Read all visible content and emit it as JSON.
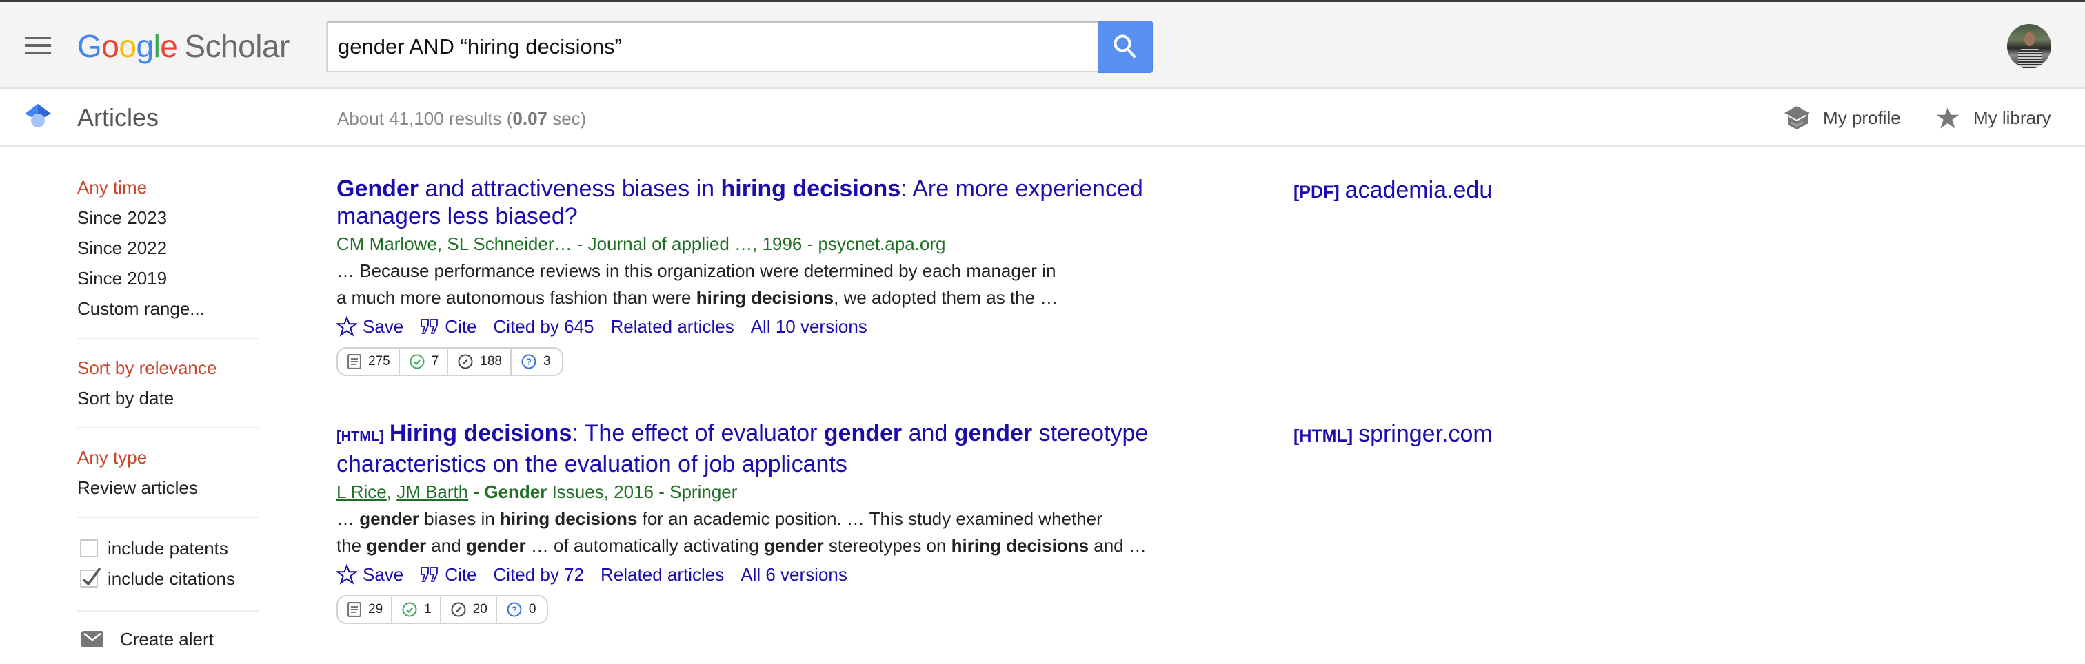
{
  "header": {
    "logo_google": [
      "G",
      "o",
      "o",
      "g",
      "l",
      "e"
    ],
    "logo_product": "Scholar",
    "search": {
      "value": "gender AND “hiring decisions”",
      "placeholder": ""
    },
    "icons": {
      "menu": "hamburger-menu-icon",
      "search": "magnifier-icon",
      "avatar": "user-avatar"
    }
  },
  "subheader": {
    "section_label": "Articles",
    "results_prefix": "About 41,100 results (",
    "results_time": "0.07",
    "results_suffix": " sec)",
    "my_profile": "My profile",
    "my_library": "My library"
  },
  "sidebar": {
    "time_filters": [
      {
        "label": "Any time",
        "active": true
      },
      {
        "label": "Since 2023",
        "active": false
      },
      {
        "label": "Since 2022",
        "active": false
      },
      {
        "label": "Since 2019",
        "active": false
      },
      {
        "label": "Custom range...",
        "active": false
      }
    ],
    "sort_options": [
      {
        "label": "Sort by relevance",
        "active": true
      },
      {
        "label": "Sort by date",
        "active": false
      }
    ],
    "type_filters": [
      {
        "label": "Any type",
        "active": true
      },
      {
        "label": "Review articles",
        "active": false
      }
    ],
    "checkboxes": [
      {
        "label": "include patents",
        "checked": false
      },
      {
        "label": "include citations",
        "checked": true
      }
    ],
    "create_alert": "Create alert"
  },
  "results": [
    {
      "title_tag": "",
      "title_parts": [
        {
          "text": "Gender",
          "bold": true
        },
        {
          "text": " and attractiveness biases in ",
          "bold": false
        },
        {
          "text": "hiring decisions",
          "bold": true
        },
        {
          "text": ": Are more experienced managers less biased?",
          "bold": false
        }
      ],
      "authors_line": "CM Marlowe, SL Schneider… - Journal of applied …, 1996 - psycnet.apa.org",
      "snippet_lines": [
        [
          {
            "text": "… Because performance reviews in this organization were determined by each manager in",
            "bold": false
          }
        ],
        [
          {
            "text": "a much more autonomous fashion than were ",
            "bold": false
          },
          {
            "text": "hiring decisions",
            "bold": true
          },
          {
            "text": ", we adopted them as the …",
            "bold": false
          }
        ]
      ],
      "actions": {
        "save": "Save",
        "cite": "Cite",
        "cited_by": "Cited by 645",
        "related": "Related articles",
        "versions": "All 10 versions"
      },
      "scite": {
        "publications": "275",
        "supporting": "7",
        "mentioning": "188",
        "contrasting": "3"
      },
      "side_link": {
        "tag": "[PDF]",
        "domain": "academia.edu"
      }
    },
    {
      "title_tag": "[HTML]",
      "title_parts": [
        {
          "text": "Hiring decisions",
          "bold": true
        },
        {
          "text": ": The effect of evaluator ",
          "bold": false
        },
        {
          "text": "gender",
          "bold": true
        },
        {
          "text": " and ",
          "bold": false
        },
        {
          "text": "gender",
          "bold": true
        },
        {
          "text": " stereotype characteristics on the evaluation of job applicants",
          "bold": false
        }
      ],
      "authors": [
        "L Rice",
        "JM Barth"
      ],
      "venue_parts": [
        {
          "text": " - ",
          "bold": false
        },
        {
          "text": "Gender",
          "bold": true
        },
        {
          "text": " Issues, 2016 - Springer",
          "bold": false
        }
      ],
      "snippet_lines": [
        [
          {
            "text": "… ",
            "bold": false
          },
          {
            "text": "gender",
            "bold": true
          },
          {
            "text": " biases in ",
            "bold": false
          },
          {
            "text": "hiring decisions",
            "bold": true
          },
          {
            "text": " for an academic position. … This study examined whether",
            "bold": false
          }
        ],
        [
          {
            "text": "the ",
            "bold": false
          },
          {
            "text": "gender",
            "bold": true
          },
          {
            "text": " and ",
            "bold": false
          },
          {
            "text": "gender",
            "bold": true
          },
          {
            "text": " … of automatically activating ",
            "bold": false
          },
          {
            "text": "gender",
            "bold": true
          },
          {
            "text": " stereotypes on ",
            "bold": false
          },
          {
            "text": "hiring decisions",
            "bold": true
          },
          {
            "text": " and …",
            "bold": false
          }
        ]
      ],
      "actions": {
        "save": "Save",
        "cite": "Cite",
        "cited_by": "Cited by 72",
        "related": "Related articles",
        "versions": "All 6 versions"
      },
      "scite": {
        "publications": "29",
        "supporting": "1",
        "mentioning": "20",
        "contrasting": "0"
      },
      "side_link": {
        "tag": "[HTML]",
        "domain": "springer.com"
      }
    }
  ],
  "colors": {
    "link": "#1a0dab",
    "author_green": "#1f6e24",
    "active_filter": "#c7472e",
    "search_button": "#5a8ff2",
    "header_bg": "#f4f4f4"
  }
}
